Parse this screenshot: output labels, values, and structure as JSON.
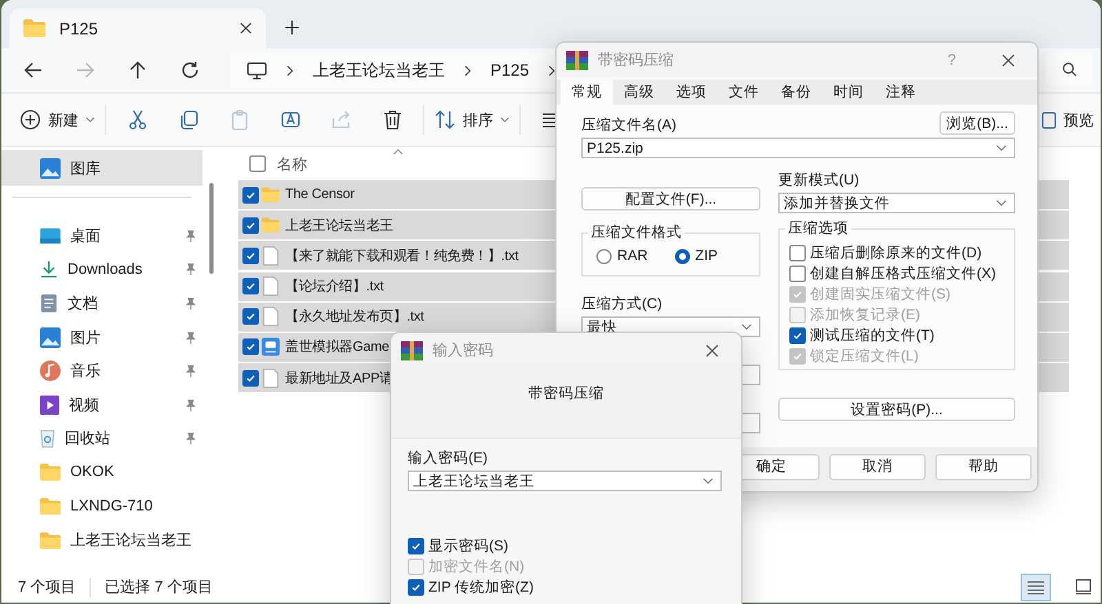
{
  "explorer": {
    "tab": {
      "label": "P125",
      "selected": true
    },
    "nav": [
      {
        "kind": "back",
        "disabled": false
      },
      {
        "kind": "forward",
        "disabled": true
      },
      {
        "kind": "up",
        "disabled": false
      },
      {
        "kind": "refresh",
        "disabled": false
      }
    ],
    "breadcrumb": [
      "上老王论坛当老王",
      "P125"
    ],
    "toolbar": [
      {
        "kind": "new",
        "label": "新建",
        "disabled": false
      },
      {
        "kind": "cut",
        "disabled": false
      },
      {
        "kind": "copy",
        "disabled": false
      },
      {
        "kind": "paste",
        "disabled": true
      },
      {
        "kind": "rename",
        "disabled": false
      },
      {
        "kind": "share",
        "disabled": true
      },
      {
        "kind": "delete",
        "disabled": false
      },
      {
        "kind": "sort",
        "label": "排序",
        "disabled": false
      },
      {
        "kind": "view",
        "disabled": false
      }
    ],
    "preview_label": "预览",
    "sidebar_top": [
      {
        "label": "图库",
        "kind": "gallery",
        "selected": true,
        "pinned": false
      }
    ],
    "sidebar": [
      {
        "label": "桌面",
        "kind": "desktop",
        "selected": false,
        "pinned": true
      },
      {
        "label": "Downloads",
        "kind": "downloads",
        "selected": false,
        "pinned": true
      },
      {
        "label": "文档",
        "kind": "documents",
        "selected": false,
        "pinned": true
      },
      {
        "label": "图片",
        "kind": "pictures",
        "selected": false,
        "pinned": true
      },
      {
        "label": "音乐",
        "kind": "music",
        "selected": false,
        "pinned": true
      },
      {
        "label": "视频",
        "kind": "videos",
        "selected": false,
        "pinned": true
      },
      {
        "label": "回收站",
        "kind": "recycle",
        "selected": false,
        "pinned": true
      },
      {
        "label": "OKOK",
        "kind": "folder",
        "selected": false,
        "pinned": false
      },
      {
        "label": "LXNDG-710",
        "kind": "folder",
        "selected": false,
        "pinned": false
      },
      {
        "label": "上老王论坛当老王",
        "kind": "folder",
        "selected": false,
        "pinned": false
      }
    ],
    "name_column": "名称",
    "all_checked": false,
    "files": [
      {
        "name": "The Censor",
        "kind": "folder",
        "selected": true
      },
      {
        "name": "上老王论坛当老王",
        "kind": "folder",
        "selected": true
      },
      {
        "name": "【来了就能下载和观看！纯免费！】.txt",
        "kind": "text",
        "selected": true
      },
      {
        "name": "【论坛介绍】.txt",
        "kind": "text",
        "selected": true
      },
      {
        "name": "【永久地址发布页】.txt",
        "kind": "text",
        "selected": true
      },
      {
        "name": "盖世模拟器Game",
        "kind": "app",
        "selected": true
      },
      {
        "name": "最新地址及APP请",
        "kind": "text",
        "selected": true
      }
    ],
    "status": {
      "count": "7 个项目",
      "selection": "已选择 7 个项目"
    },
    "views": [
      {
        "kind": "details",
        "selected": true
      },
      {
        "kind": "tiles",
        "selected": false
      }
    ]
  },
  "archive_dialog": {
    "title": "带密码压缩",
    "help": "?",
    "tabs": [
      {
        "label": "常规",
        "selected": true
      },
      {
        "label": "高级",
        "selected": false
      },
      {
        "label": "选项",
        "selected": false
      },
      {
        "label": "文件",
        "selected": false
      },
      {
        "label": "备份",
        "selected": false
      },
      {
        "label": "时间",
        "selected": false
      },
      {
        "label": "注释",
        "selected": false
      }
    ],
    "archive_name_label": "压缩文件名(A)",
    "browse_button": "浏览(B)...",
    "archive_name": "P125.zip",
    "profiles_button": "配置文件(F)...",
    "update_mode_label": "更新模式(U)",
    "update_mode": "添加并替换文件",
    "format_group": "压缩文件格式",
    "formats": [
      {
        "label": "RAR",
        "selected": false
      },
      {
        "label": "ZIP",
        "selected": true
      }
    ],
    "method_label": "压缩方式(C)",
    "method": "最快",
    "options_group": "压缩选项",
    "options": [
      {
        "label": "压缩后删除原来的文件(D)",
        "checked": false,
        "disabled": false
      },
      {
        "label": "创建自解压格式压缩文件(X)",
        "checked": false,
        "disabled": false
      },
      {
        "label": "创建固实压缩文件(S)",
        "checked": true,
        "disabled": true
      },
      {
        "label": "添加恢复记录(E)",
        "checked": false,
        "disabled": true
      },
      {
        "label": "测试压缩的文件(T)",
        "checked": true,
        "disabled": false
      },
      {
        "label": "锁定压缩文件(L)",
        "checked": true,
        "disabled": true
      }
    ],
    "password_button": "设置密码(P)...",
    "buttons": [
      "确定",
      "取消",
      "帮助"
    ]
  },
  "password_dialog": {
    "title": "输入密码",
    "subtitle": "带密码压缩",
    "password_label": "输入密码(E)",
    "password": "上老王论坛当老王",
    "options": [
      {
        "label": "显示密码(S)",
        "checked": true,
        "disabled": false
      },
      {
        "label": "加密文件名(N)",
        "checked": false,
        "disabled": true
      },
      {
        "label": "ZIP 传统加密(Z)",
        "checked": true,
        "disabled": false
      }
    ]
  }
}
